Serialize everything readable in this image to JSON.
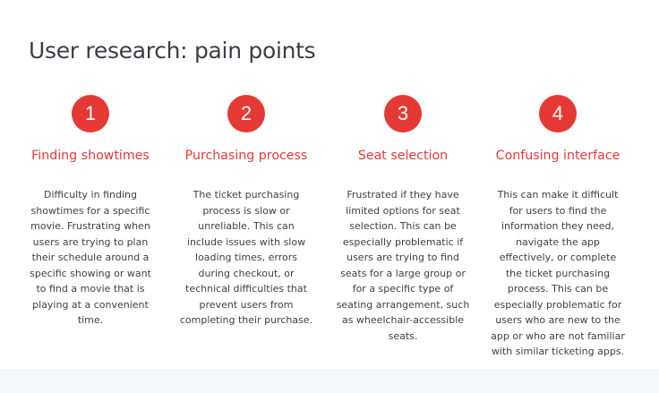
{
  "page": {
    "title": "User research: pain points"
  },
  "colors": {
    "accent": "#e53935",
    "title_text": "#3b3f45",
    "body_text": "#3d4046",
    "background": "#ffffff"
  },
  "pain_points": [
    {
      "number": "1",
      "heading": "Finding showtimes",
      "body": "Difficulty in finding showtimes for a specific movie. Frustrating when users are trying to plan their schedule around a specific showing or want to find a movie that is playing at a convenient time."
    },
    {
      "number": "2",
      "heading": "Purchasing process",
      "body": "The ticket purchasing process is slow or unreliable. This can include issues with slow loading times, errors during checkout, or technical difficulties that prevent users from completing their purchase."
    },
    {
      "number": "3",
      "heading": "Seat selection",
      "body": "Frustrated if they have limited options for seat selection. This can be especially problematic if users are trying to find seats for a large group or for a specific type of seating arrangement, such as wheelchair-accessible seats."
    },
    {
      "number": "4",
      "heading": "Confusing interface",
      "body": "This can make it difficult for users to find the information they need, navigate the app effectively, or complete the ticket purchasing process. This can be especially problematic for users who are new to the app or who are not familiar with similar ticketing apps."
    }
  ]
}
